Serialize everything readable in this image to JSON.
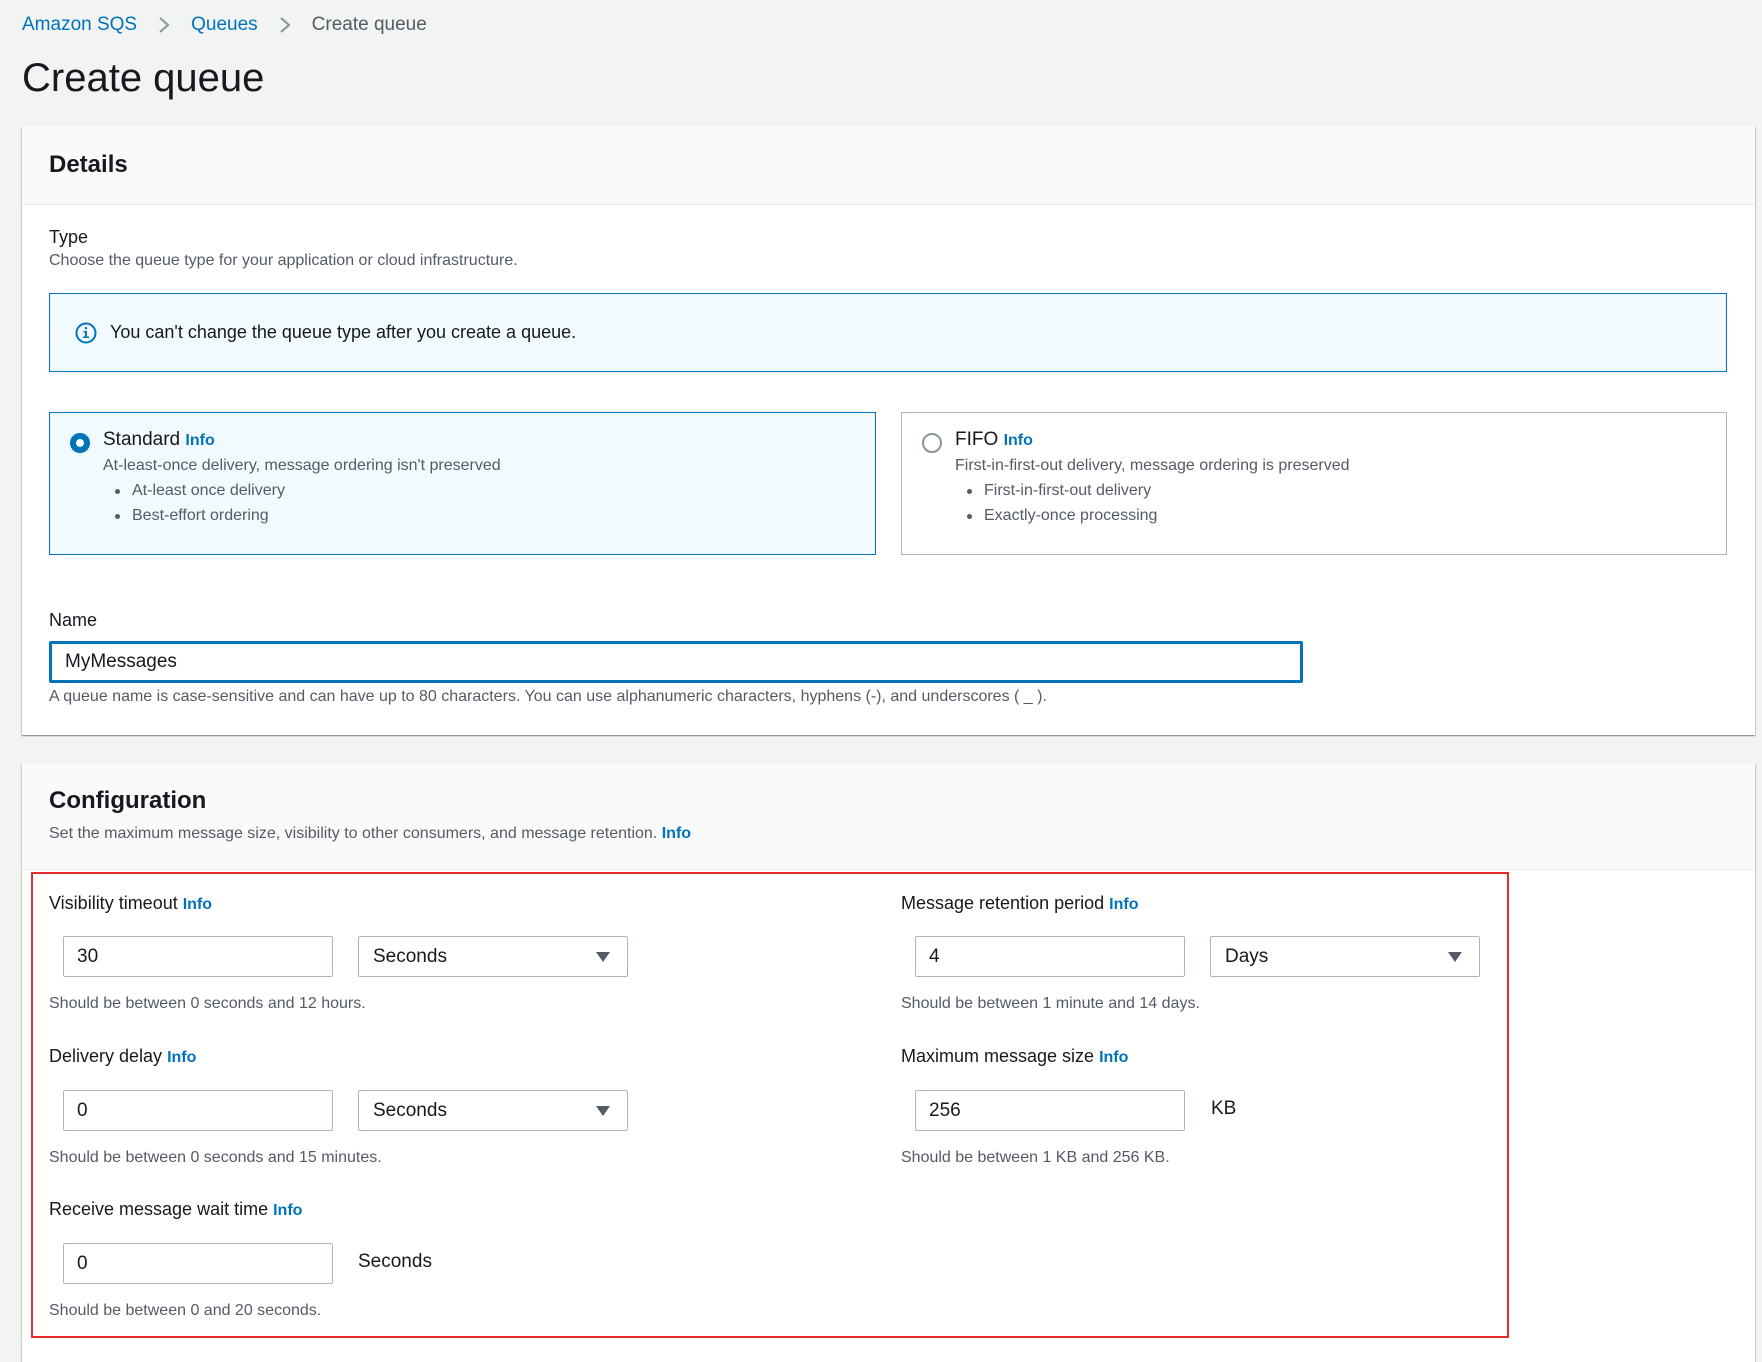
{
  "breadcrumb": {
    "items": [
      "Amazon SQS",
      "Queues"
    ],
    "current": "Create queue"
  },
  "page_title": "Create queue",
  "details": {
    "title": "Details",
    "type_label": "Type",
    "type_desc": "Choose the queue type for your application or cloud infrastructure.",
    "alert_text": "You can't change the queue type after you create a queue.",
    "standard": {
      "title": "Standard",
      "info": "Info",
      "sub": "At-least-once delivery, message ordering isn't preserved",
      "bullets": [
        "At-least once delivery",
        "Best-effort ordering"
      ],
      "selected": true
    },
    "fifo": {
      "title": "FIFO",
      "info": "Info",
      "sub": "First-in-first-out delivery, message ordering is preserved",
      "bullets": [
        "First-in-first-out delivery",
        "Exactly-once processing"
      ],
      "selected": false
    },
    "name_label": "Name",
    "name_value": "MyMessages",
    "name_hint": "A queue name is case-sensitive and can have up to 80 characters. You can use alphanumeric characters, hyphens (-), and underscores ( _ )."
  },
  "configuration": {
    "title": "Configuration",
    "desc": "Set the maximum message size, visibility to other consumers, and message retention.",
    "info": "Info",
    "visibility_timeout": {
      "label": "Visibility timeout",
      "info": "Info",
      "value": "30",
      "unit": "Seconds",
      "hint": "Should be between 0 seconds and 12 hours."
    },
    "retention_period": {
      "label": "Message retention period",
      "info": "Info",
      "value": "4",
      "unit": "Days",
      "hint": "Should be between 1 minute and 14 days."
    },
    "delivery_delay": {
      "label": "Delivery delay",
      "info": "Info",
      "value": "0",
      "unit": "Seconds",
      "hint": "Should be between 0 seconds and 15 minutes."
    },
    "max_message_size": {
      "label": "Maximum message size",
      "info": "Info",
      "value": "256",
      "unit": "KB",
      "hint": "Should be between 1 KB and 256 KB."
    },
    "receive_wait_time": {
      "label": "Receive message wait time",
      "info": "Info",
      "value": "0",
      "unit": "Seconds",
      "hint": "Should be between 0 and 20 seconds."
    }
  },
  "colors": {
    "link": "#0073bb",
    "highlight": "#e52b2b",
    "background": "#f2f3f3"
  },
  "icons": [
    "chevron-right-icon",
    "info-circle-icon",
    "caret-down-icon"
  ]
}
